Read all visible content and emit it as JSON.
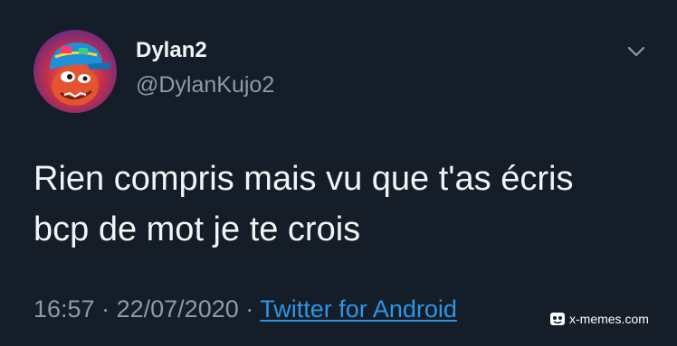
{
  "tweet": {
    "author": {
      "display_name": "Dylan2",
      "handle": "@DylanKujo2"
    },
    "text_lines": [
      "Rien compris mais vu que t'as écris",
      "bcp de mot je te crois"
    ],
    "time": "16:57",
    "separator": "·",
    "date": "22/07/2020",
    "source": "Twitter for Android"
  },
  "watermark": {
    "text": "x-memes.com"
  },
  "icons": {
    "menu": "chevron-down-icon",
    "avatar": "avatar-image",
    "watermark_logo": "x-memes-logo"
  },
  "colors": {
    "background": "#151d28",
    "primary_text": "#f2f4f6",
    "secondary_text": "#8f9aa6",
    "link": "#2d95e8"
  }
}
